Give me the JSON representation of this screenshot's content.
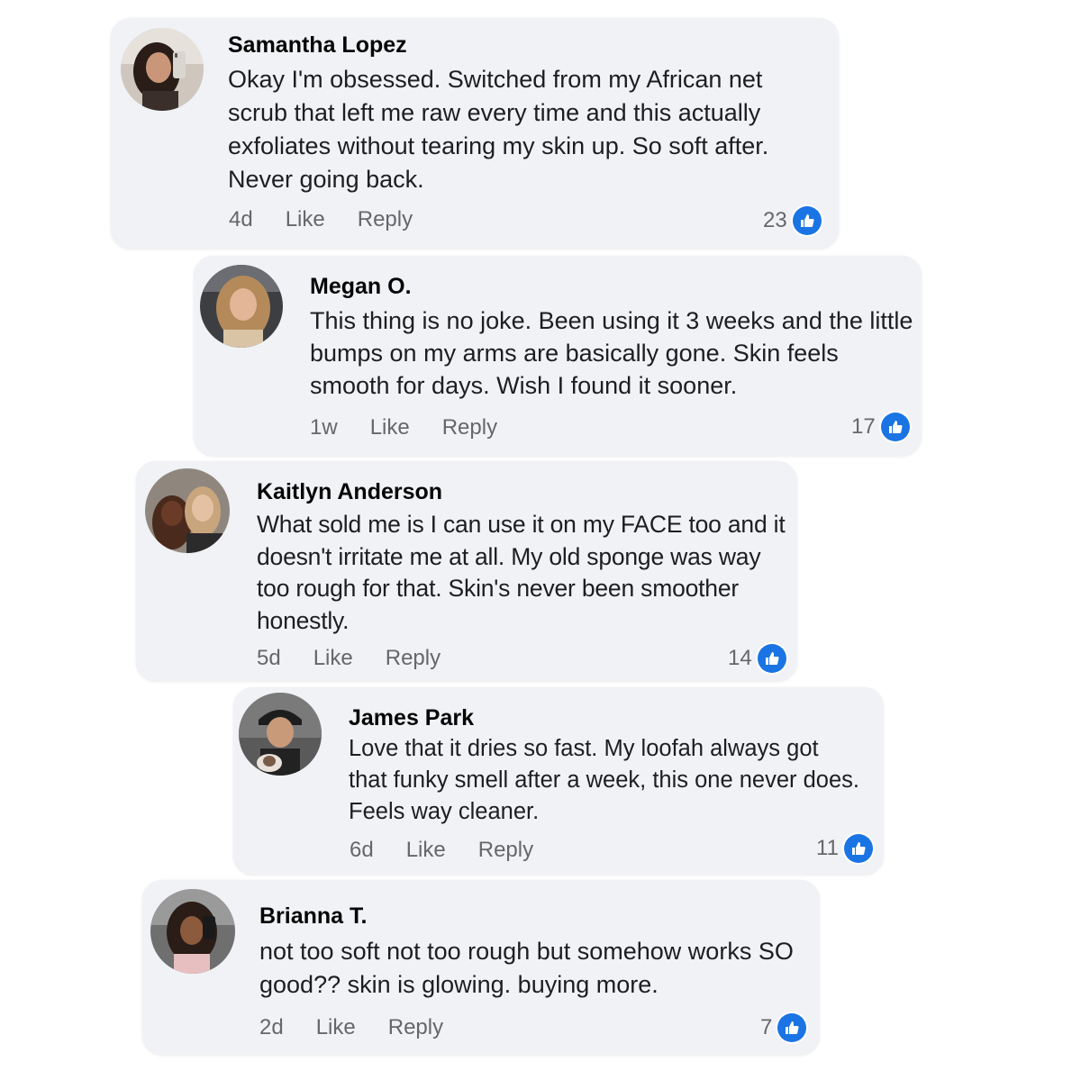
{
  "comments": [
    {
      "author": "Samantha Lopez",
      "text": "Okay I'm obsessed. Switched from my African net scrub that left me raw every time and this actually exfoliates without tearing my skin up. So soft after. Never going back.",
      "time": "4d",
      "like_label": "Like",
      "reply_label": "Reply",
      "reactions": "23"
    },
    {
      "author": "Megan O.",
      "text": "This thing is no joke. Been using it 3 weeks and the little bumps on my arms are basically gone. Skin feels smooth for days. Wish I found it sooner.",
      "time": "1w",
      "like_label": "Like",
      "reply_label": "Reply",
      "reactions": "17"
    },
    {
      "author": "Kaitlyn Anderson",
      "text": "What sold me is I can use it on my FACE too and it doesn't irritate me at all. My old sponge was way too rough for that. Skin's never been smoother honestly.",
      "time": "5d",
      "like_label": "Like",
      "reply_label": "Reply",
      "reactions": "14"
    },
    {
      "author": "James Park",
      "text": "Love that it dries so fast. My loofah always got that funky smell after a week, this one never does. Feels way cleaner.",
      "time": "6d",
      "like_label": "Like",
      "reply_label": "Reply",
      "reactions": "11"
    },
    {
      "author": "Brianna T.",
      "text": "not too soft not too rough but somehow works SO good?? skin is glowing. buying more.",
      "time": "2d",
      "like_label": "Like",
      "reply_label": "Reply",
      "reactions": "7"
    }
  ],
  "colors": {
    "bubble": "#f0f2f5",
    "like_badge": "#1b74e4",
    "meta_text": "#65676b"
  },
  "icons": {
    "reaction": "thumbs-up-icon",
    "avatar": "user-photo"
  }
}
